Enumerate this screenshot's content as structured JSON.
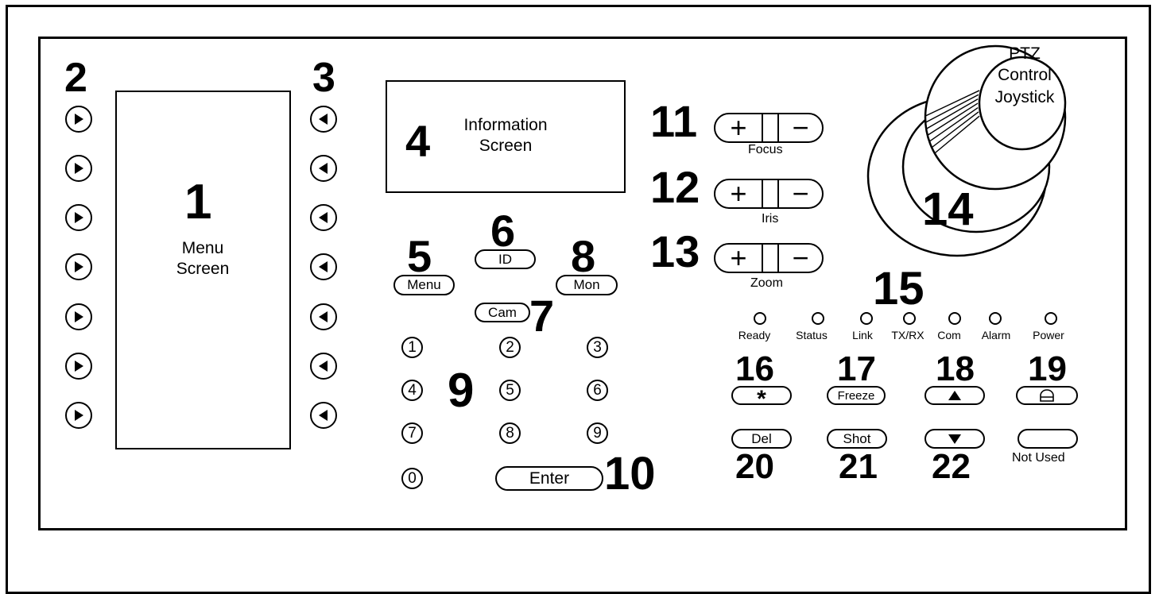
{
  "callouts": {
    "menu_screen": "1",
    "left_keys": "2",
    "right_keys": "3",
    "info_screen": "4",
    "menu_key": "5",
    "id_key": "6",
    "cam_key": "7",
    "mon_key": "8",
    "numpad": "9",
    "enter_key": "10",
    "focus": "11",
    "iris": "12",
    "zoom": "13",
    "joystick": "14",
    "leds": "15",
    "star_key": "16",
    "freeze_key": "17",
    "up_key": "18",
    "lock_key": "19",
    "del_key": "20",
    "shot_key": "21",
    "down_key": "22"
  },
  "menu_screen": {
    "line1": "Menu",
    "line2": "Screen"
  },
  "info_screen": {
    "line1": "Information",
    "line2": "Screen"
  },
  "keys": {
    "menu": "Menu",
    "id": "ID",
    "cam": "Cam",
    "mon": "Mon",
    "enter": "Enter",
    "freeze": "Freeze",
    "del": "Del",
    "shot": "Shot",
    "star": "*"
  },
  "numpad": [
    "1",
    "2",
    "3",
    "4",
    "5",
    "6",
    "7",
    "8",
    "9",
    "0"
  ],
  "adjust": {
    "focus": "Focus",
    "iris": "Iris",
    "zoom": "Zoom",
    "plus": "+",
    "minus": "−"
  },
  "joystick": {
    "line1": "PTZ",
    "line2": "Control",
    "line3": "Joystick"
  },
  "leds": [
    "Ready",
    "Status",
    "Link",
    "TX/RX",
    "Com",
    "Alarm",
    "Power"
  ],
  "not_used": "Not Used",
  "icons": {
    "left_keys": "play-right-icon",
    "right_keys": "play-left-icon",
    "up": "triangle-up-icon",
    "down": "triangle-down-icon",
    "lock": "lock-icon"
  }
}
